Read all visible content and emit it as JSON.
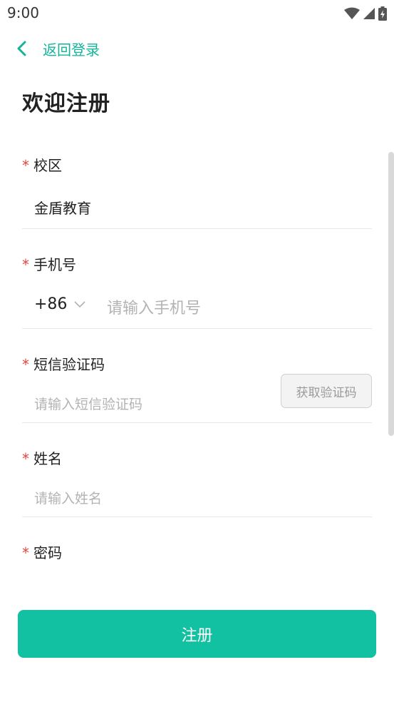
{
  "status_bar": {
    "time": "9:00"
  },
  "nav": {
    "back_label": "返回登录"
  },
  "page": {
    "title": "欢迎注册"
  },
  "form": {
    "required_mark": "*",
    "campus": {
      "label": "校区",
      "value": "金盾教育"
    },
    "phone": {
      "label": "手机号",
      "country_code": "+86",
      "placeholder": "请输入手机号"
    },
    "sms_code": {
      "label": "短信验证码",
      "placeholder": "请输入短信验证码",
      "button_label": "获取验证码"
    },
    "name": {
      "label": "姓名",
      "placeholder": "请输入姓名"
    },
    "password": {
      "label": "密码"
    }
  },
  "submit": {
    "label": "注册"
  },
  "colors": {
    "accent": "#12c1a2",
    "required": "#e5443d",
    "placeholder": "#b3b3b3"
  }
}
